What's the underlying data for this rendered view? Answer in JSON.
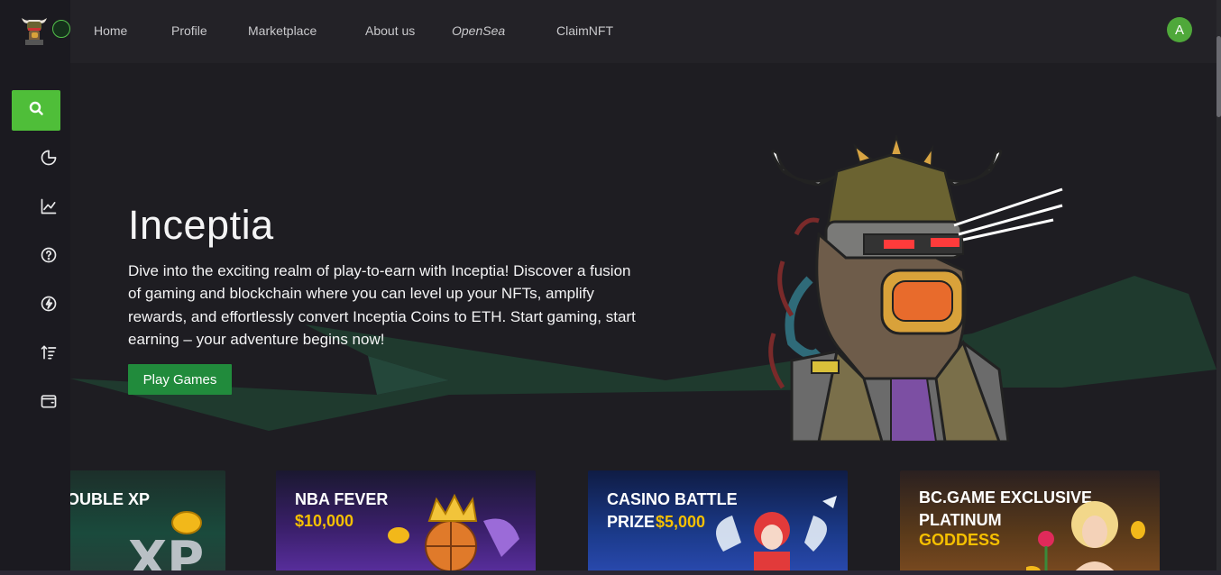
{
  "nav": {
    "items": [
      {
        "label": "Home"
      },
      {
        "label": "Profile"
      },
      {
        "label": "Marketplace"
      },
      {
        "label": "About us"
      },
      {
        "label": "OpenSea"
      },
      {
        "label": "ClaimNFT"
      }
    ],
    "avatar_initial": "A"
  },
  "sidebar": {
    "icons": [
      "search-icon",
      "pie-chart-icon",
      "line-chart-icon",
      "help-circle-icon",
      "lightning-icon",
      "sort-icon",
      "wallet-icon"
    ],
    "accent": "#4fbe39"
  },
  "hero": {
    "title": "Inceptia",
    "description": "Dive into the exciting realm of play-to-earn with Inceptia! Discover a fusion of gaming and blockchain where you can level up your NFTs, amplify rewards, and effortlessly convert Inceptia Coins to ETH. Start gaming, start earning – your adventure begins now!",
    "cta": "Play Games"
  },
  "promos": [
    {
      "line1": "OUBLE XP",
      "line2": "",
      "accent": ""
    },
    {
      "line1": "NBA FEVER",
      "line2": "",
      "accent": "$10,000"
    },
    {
      "line1": "CASINO BATTLE",
      "line2": "PRIZE",
      "accent": "$5,000"
    },
    {
      "line1": "BC.GAME EXCLUSIVE",
      "line2": "PLATINUM",
      "accent": "GODDESS"
    }
  ],
  "colors": {
    "background": "#1e1d22",
    "topbar": "#232227",
    "cta": "#218b3c",
    "gold": "#f6c000"
  }
}
